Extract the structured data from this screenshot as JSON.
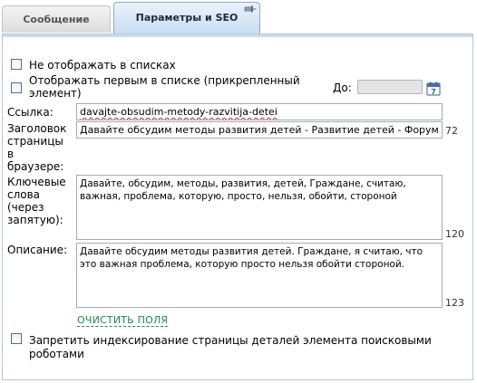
{
  "tabs": [
    {
      "label": "Сообщение"
    },
    {
      "label": "Параметры и SEO"
    }
  ],
  "options": {
    "hide_in_lists": "Не отображать в списках",
    "show_first_line1": "Отображать первым в списке (прикрепленный",
    "show_first_line2": "элемент)",
    "until_label": "До:",
    "until_value": ""
  },
  "form": {
    "link_label": "Ссылка:",
    "link_value": "davajte-obsudim-metody-razvitija-detei",
    "title_label_lines": [
      "Заголовок",
      "страницы",
      "в",
      "браузере:"
    ],
    "title_value": "Давайте обсудим  методы развития детей - Развитие детей - Форум",
    "title_count": "72",
    "keywords_label_lines": [
      "Ключевые",
      "слова",
      "(через",
      "запятую):"
    ],
    "keywords_value": "Давайте, обсудим, методы, развития, детей, Граждане, считаю, важная, проблема, которую, просто, нельзя, обойти, стороной",
    "keywords_count": "120",
    "description_label": "Описание:",
    "description_value": "Давайте обсудим  методы развития детей. Граждане, я считаю, что это важная проблема, которую просто нельзя обойти стороной.",
    "description_count": "123",
    "clear_label": "ОЧИСТИТЬ ПОЛЯ"
  },
  "noindex": {
    "line1": "Запретить индексирование страницы деталей элемента поисковыми",
    "line2": "роботами"
  },
  "colors": {
    "active_tab": "#c9dcf0",
    "clear_link": "#1e8a4a",
    "border": "#a5acb2"
  }
}
